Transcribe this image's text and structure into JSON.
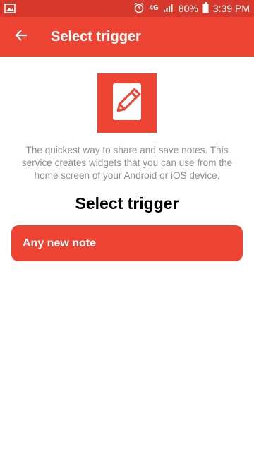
{
  "status_bar": {
    "battery": "80%",
    "time": "3:39 PM",
    "network": "4G",
    "icons": [
      "image-icon",
      "alarm-icon",
      "network-4g-icon",
      "signal-icon",
      "battery-icon"
    ]
  },
  "app_bar": {
    "title": "Select trigger",
    "back_icon": "arrow-left-icon"
  },
  "service": {
    "icon": "note-pencil-icon",
    "description": "The quickest way to share and save notes. This service creates widgets that you can use from the home screen of your Android or iOS device."
  },
  "main": {
    "section_title": "Select trigger",
    "triggers": [
      {
        "label": "Any new note"
      }
    ]
  },
  "colors": {
    "status_bar": "#d6392b",
    "accent": "#ee4433",
    "description_text": "#8f8f8f"
  }
}
